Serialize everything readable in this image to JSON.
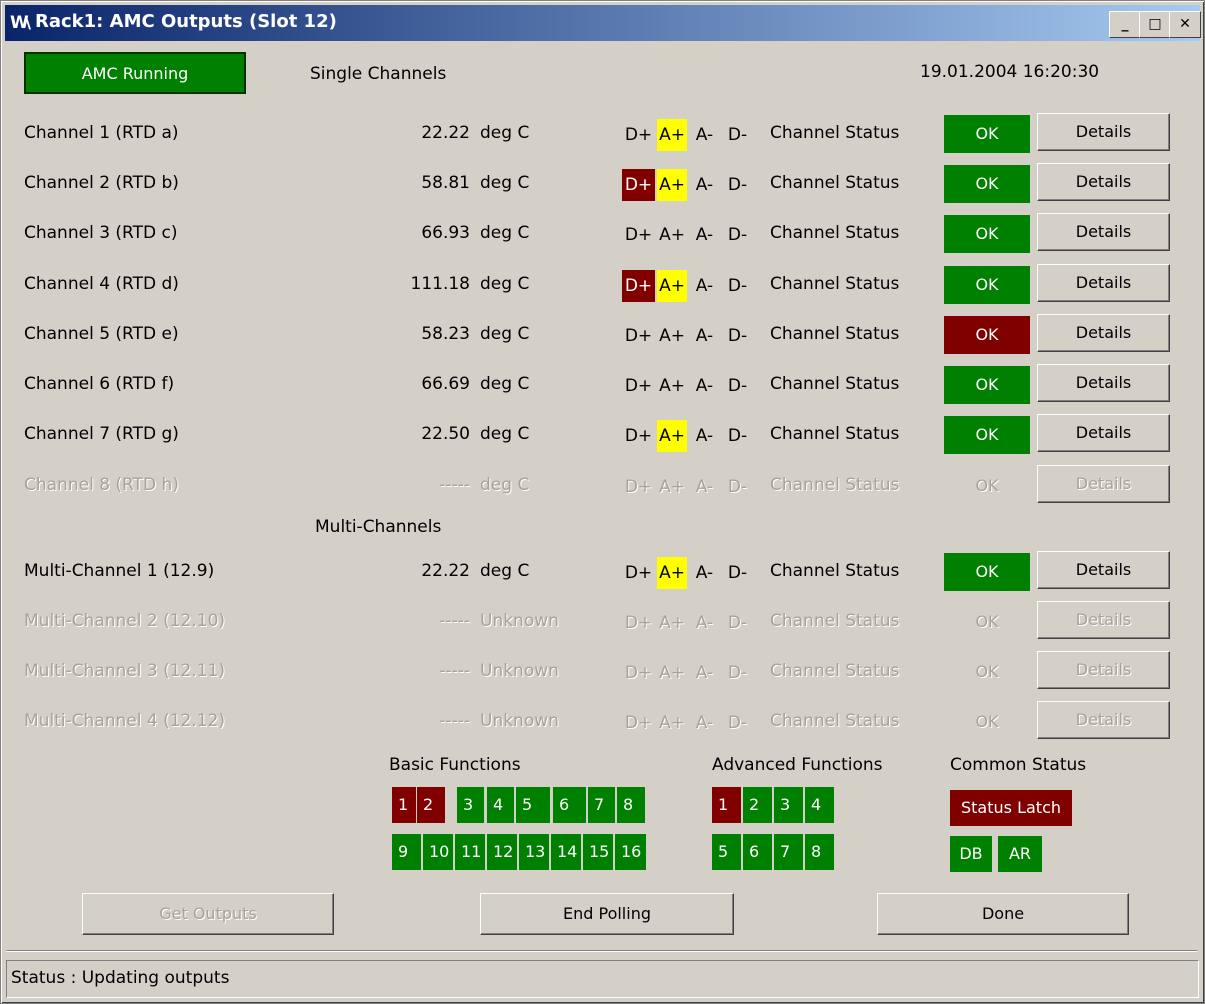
{
  "window": {
    "title": "Rack1: AMC Outputs (Slot 12)",
    "minimize": "_",
    "maximize": "□",
    "close": "✕"
  },
  "top": {
    "running_label": "AMC Running",
    "single_heading": "Single Channels",
    "datetime": "19.01.2004 16:20:30",
    "multi_heading": "Multi-Channels"
  },
  "common": {
    "flags": [
      "D+",
      "A+",
      "A-",
      "D-"
    ],
    "status_label": "Channel Status",
    "ok_label": "OK",
    "details_label": "Details"
  },
  "channels": [
    {
      "name": "Channel  1 (RTD a)",
      "value": "22.22",
      "unit": "deg C",
      "active": true,
      "flags_state": [
        "",
        "yellow",
        "",
        ""
      ],
      "ok_color": "green"
    },
    {
      "name": "Channel  2 (RTD b)",
      "value": "58.81",
      "unit": "deg C",
      "active": true,
      "flags_state": [
        "red",
        "yellow",
        "",
        ""
      ],
      "ok_color": "green"
    },
    {
      "name": "Channel  3 (RTD c)",
      "value": "66.93",
      "unit": "deg C",
      "active": true,
      "flags_state": [
        "",
        "",
        "",
        ""
      ],
      "ok_color": "green"
    },
    {
      "name": "Channel  4 (RTD d)",
      "value": "111.18",
      "unit": "deg C",
      "active": true,
      "flags_state": [
        "red",
        "yellow",
        "",
        ""
      ],
      "ok_color": "green"
    },
    {
      "name": "Channel  5 (RTD e)",
      "value": "58.23",
      "unit": "deg C",
      "active": true,
      "flags_state": [
        "",
        "",
        "",
        ""
      ],
      "ok_color": "red"
    },
    {
      "name": "Channel  6 (RTD f)",
      "value": "66.69",
      "unit": "deg C",
      "active": true,
      "flags_state": [
        "",
        "",
        "",
        ""
      ],
      "ok_color": "green"
    },
    {
      "name": "Channel  7 (RTD g)",
      "value": "22.50",
      "unit": "deg C",
      "active": true,
      "flags_state": [
        "",
        "yellow",
        "",
        ""
      ],
      "ok_color": "green"
    },
    {
      "name": "Channel  8 (RTD h)",
      "value": "-----",
      "unit": "deg C",
      "active": false,
      "flags_state": [
        "",
        "",
        "",
        ""
      ],
      "ok_color": "none"
    }
  ],
  "multi_channels": [
    {
      "name": "Multi-Channel 1 (12.9)",
      "value": "22.22",
      "unit": "deg C",
      "active": true,
      "flags_state": [
        "",
        "yellow",
        "",
        ""
      ],
      "ok_color": "green"
    },
    {
      "name": "Multi-Channel 2 (12.10)",
      "value": "-----",
      "unit": "Unknown",
      "active": false,
      "flags_state": [
        "",
        "",
        "",
        ""
      ],
      "ok_color": "none"
    },
    {
      "name": "Multi-Channel 3 (12.11)",
      "value": "-----",
      "unit": "Unknown",
      "active": false,
      "flags_state": [
        "",
        "",
        "",
        ""
      ],
      "ok_color": "none"
    },
    {
      "name": "Multi-Channel 4 (12.12)",
      "value": "-----",
      "unit": "Unknown",
      "active": false,
      "flags_state": [
        "",
        "",
        "",
        ""
      ],
      "ok_color": "none"
    }
  ],
  "functions": {
    "basic_heading": "Basic Functions",
    "basic": [
      {
        "label": "1",
        "color": "red"
      },
      {
        "label": "2",
        "color": "red"
      },
      {
        "label": "3",
        "color": "green"
      },
      {
        "label": "4",
        "color": "green"
      },
      {
        "label": "5",
        "color": "green"
      },
      {
        "label": "6",
        "color": "green"
      },
      {
        "label": "7",
        "color": "green"
      },
      {
        "label": "8",
        "color": "green"
      },
      {
        "label": "9",
        "color": "green"
      },
      {
        "label": "10",
        "color": "green"
      },
      {
        "label": "11",
        "color": "green"
      },
      {
        "label": "12",
        "color": "green"
      },
      {
        "label": "13",
        "color": "green"
      },
      {
        "label": "14",
        "color": "green"
      },
      {
        "label": "15",
        "color": "green"
      },
      {
        "label": "16",
        "color": "green"
      }
    ],
    "advanced_heading": "Advanced Functions",
    "advanced": [
      {
        "label": "1",
        "color": "red"
      },
      {
        "label": "2",
        "color": "green"
      },
      {
        "label": "3",
        "color": "green"
      },
      {
        "label": "4",
        "color": "green"
      },
      {
        "label": "5",
        "color": "green"
      },
      {
        "label": "6",
        "color": "green"
      },
      {
        "label": "7",
        "color": "green"
      },
      {
        "label": "8",
        "color": "green"
      }
    ],
    "common_heading": "Common Status",
    "status_latch": "Status Latch",
    "db": "DB",
    "ar": "AR"
  },
  "buttons": {
    "get_outputs": "Get Outputs",
    "end_polling": "End Polling",
    "done": "Done"
  },
  "statusbar": {
    "text": "Status : Updating outputs"
  },
  "colors": {
    "green": "#008000",
    "red": "#800000",
    "yellow": "#ffff00",
    "disabled_text": "#a7a39b"
  }
}
